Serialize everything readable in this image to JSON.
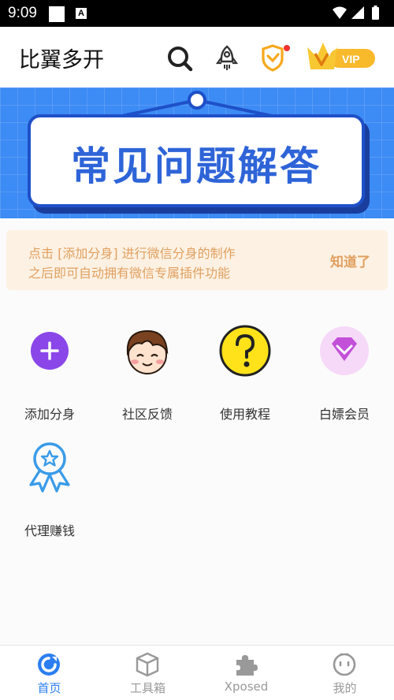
{
  "status_bar": {
    "time": "9:09",
    "notification_letter": "A"
  },
  "header": {
    "title": "比翼多开",
    "vip_label": "VIP"
  },
  "banner": {
    "title": "常见问题解答"
  },
  "notice": {
    "line1": "点击 [添加分身] 进行微信分身的制作",
    "line2": "之后即可自动拥有微信专属插件功能",
    "dismiss_label": "知道了"
  },
  "features": [
    {
      "label": "添加分身",
      "icon": "plus-circle-icon"
    },
    {
      "label": "社区反馈",
      "icon": "cartoon-face-icon"
    },
    {
      "label": "使用教程",
      "icon": "question-mark-icon"
    },
    {
      "label": "白嫖会员",
      "icon": "diamond-icon"
    },
    {
      "label": "代理赚钱",
      "icon": "award-ribbon-icon"
    }
  ],
  "bottom_nav": {
    "items": [
      {
        "label": "首页",
        "icon": "home-icon",
        "active": true
      },
      {
        "label": "工具箱",
        "icon": "box-icon",
        "active": false
      },
      {
        "label": "Xposed",
        "icon": "puzzle-icon",
        "active": false
      },
      {
        "label": "我的",
        "icon": "profile-face-icon",
        "active": false
      }
    ]
  },
  "colors": {
    "accent": "#2c7ef0",
    "banner_blue": "#3d8bf5",
    "notice_bg": "#fdf1e3",
    "notice_text": "#e0a060",
    "vip_gold": "#f8b92a"
  }
}
